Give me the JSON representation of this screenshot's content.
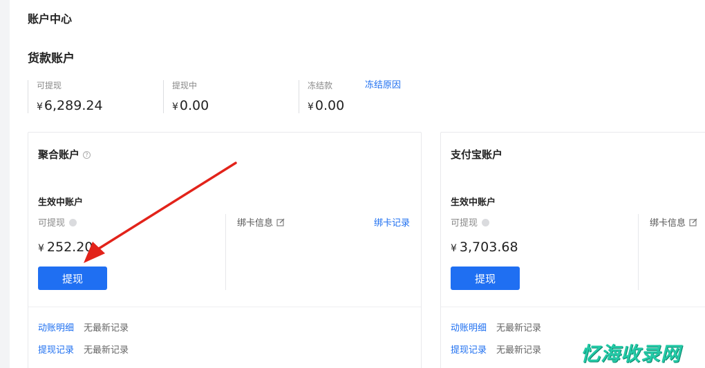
{
  "page": {
    "title": "账户中心",
    "section_title": "货款账户"
  },
  "summary": {
    "withdrawable": {
      "label": "可提现",
      "currency": "¥",
      "amount": "6,289.24"
    },
    "withdrawing": {
      "label": "提现中",
      "currency": "¥",
      "amount": "0.00"
    },
    "frozen": {
      "label": "冻结款",
      "currency": "¥",
      "amount": "0.00",
      "reason_link": "冻结原因"
    }
  },
  "cards": {
    "aggregate": {
      "title": "聚合账户",
      "active_label": "生效中账户",
      "withdrawable_label": "可提现",
      "currency": "¥",
      "amount": "252.20",
      "withdraw_button": "提现",
      "bind_info_label": "绑卡信息",
      "bind_record_link": "绑卡记录",
      "ledger_link": "动账明细",
      "ledger_status": "无最新记录",
      "withdraw_record_link": "提现记录",
      "withdraw_record_status": "无最新记录"
    },
    "alipay": {
      "title": "支付宝账户",
      "active_label": "生效中账户",
      "withdrawable_label": "可提现",
      "currency": "¥",
      "amount": "3,703.68",
      "withdraw_button": "提现",
      "bind_info_label": "绑卡信息",
      "ledger_link": "动账明细",
      "ledger_status": "无最新记录",
      "withdraw_record_link": "提现记录",
      "withdraw_record_status": "无最新记录"
    }
  },
  "watermark": {
    "text": "忆海收录网"
  },
  "colors": {
    "accent": "#1f6ff2",
    "link": "#1e6ff0",
    "arrow": "#e2231a",
    "watermark": "#23c9a6"
  },
  "icons": {
    "help": "help-circle-icon",
    "info_dot": "info-dot-icon",
    "edit": "edit-icon",
    "arrow": "red-arrow-annotation"
  }
}
